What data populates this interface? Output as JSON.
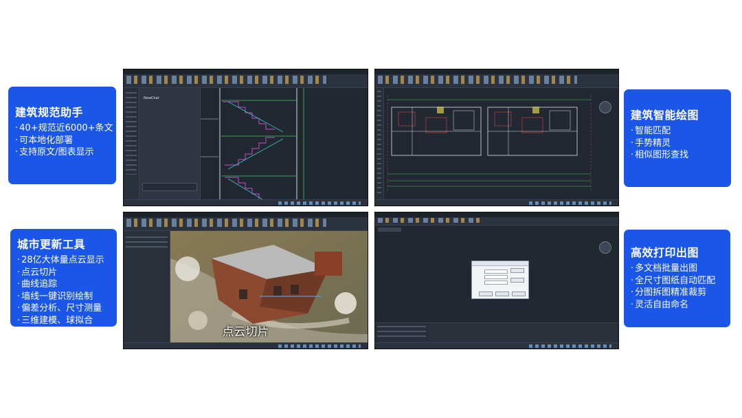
{
  "cards": [
    {
      "title": "建筑规范助手",
      "items": [
        "40+规范近6000+条文",
        "可本地化部署",
        "支持原文/图表显示"
      ]
    },
    {
      "title": "建筑智能绘图",
      "items": [
        "智能匹配",
        "手势精灵",
        "相似图形查找"
      ]
    },
    {
      "title": "城市更新工具",
      "items": [
        "28亿大体量点云显示",
        "点云切片",
        "曲线追踪",
        "墙线一键识别绘制",
        "偏差分析、尺寸测量",
        "三维建模、球拟合"
      ]
    },
    {
      "title": "高效打印出图",
      "items": [
        "多文档批量出图",
        "全尺寸图纸自动匹配",
        "分图拆图精准裁剪",
        "灵活自由命名"
      ]
    }
  ],
  "screens": {
    "top_left": {
      "panel_title": "NewChat"
    },
    "bottom_left": {
      "caption": "点云切片"
    }
  },
  "colors": {
    "card_bg": "#1a56e8",
    "cad_bg": "#222831"
  }
}
